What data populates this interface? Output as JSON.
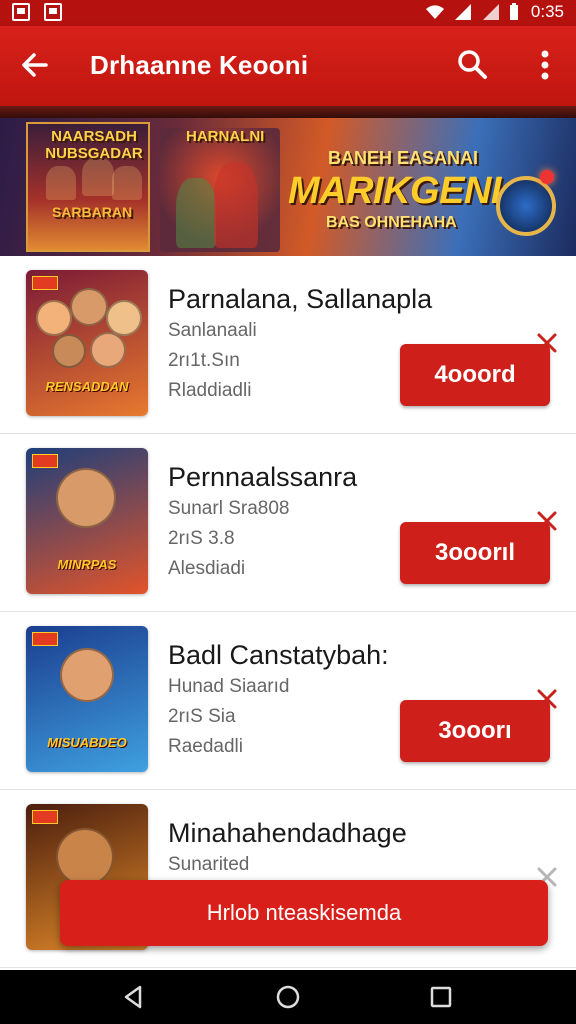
{
  "status_bar": {
    "time": "0:35"
  },
  "app_bar": {
    "title": "Drhaanne Keooni"
  },
  "banner": {
    "top_left": "NAARSADH NUBSGADAR",
    "bottom_left": "SARBARAN",
    "mid_top": "HARNALNI",
    "line1": "BANEH EASANAI",
    "line2": "MARIKGENI",
    "line3": "BAS OHNEHAHA"
  },
  "items": [
    {
      "name": "Parnalana, Sallanapla",
      "sub1": "Sanlanaali",
      "sub2": "2rı1t.Sın",
      "sub3": "Rladdiadli",
      "button": "4ooord",
      "thumb_title": "RENSADDAN",
      "thumb_colors": [
        "#7b1a36",
        "#e8792f"
      ]
    },
    {
      "name": "Pernnaalssanra",
      "sub1": "Sunarl Sra808",
      "sub2": "2rıS 3.8",
      "sub3": "Alesdiadi",
      "button": "3ooorıl",
      "thumb_title": "MINRPAS",
      "thumb_colors": [
        "#1e3f7a",
        "#e2542a"
      ]
    },
    {
      "name": "Badl Canstatybah:",
      "sub1": "Hunad Siaarıd",
      "sub2": "2rıS Sia",
      "sub3": "Raedadli",
      "button": "3ooorı",
      "thumb_title": "MISUABDEO",
      "thumb_colors": [
        "#1b3d8f",
        "#3fa0e0"
      ]
    },
    {
      "name": "Minahahendadhage",
      "sub1": "Sunarited",
      "sub2": "",
      "sub3": "",
      "button": "",
      "thumb_title": "",
      "thumb_colors": [
        "#4a1e0e",
        "#e28a2a"
      ]
    }
  ],
  "bottom_banner": {
    "label": "Hrlob nteaskisemda"
  },
  "colors": {
    "primary": "#d8211a",
    "button": "#cf1f1a",
    "text": "#1a1a1a",
    "subtext": "#666666"
  },
  "icons": {
    "back": "arrow-left-icon",
    "search": "search-icon",
    "more": "more-vert-icon",
    "close": "close-icon",
    "nav_back": "triangle-back-icon",
    "nav_home": "circle-home-icon",
    "nav_recent": "square-recent-icon"
  }
}
